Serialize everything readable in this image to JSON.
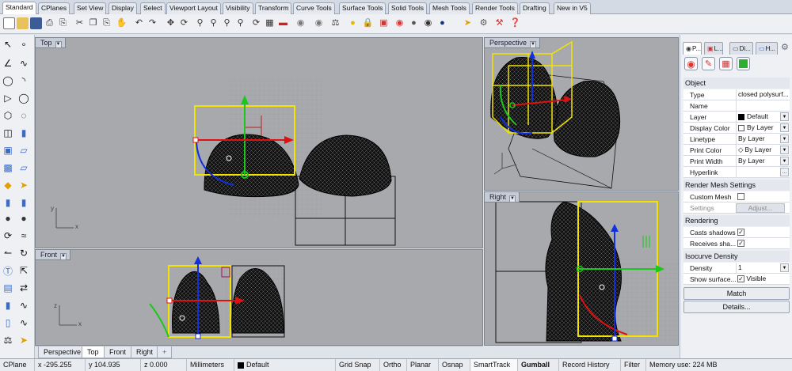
{
  "tabs": [
    {
      "label": "Standard",
      "active": true
    },
    {
      "label": "CPlanes"
    },
    {
      "label": "Set View"
    },
    {
      "label": "Display"
    },
    {
      "label": "Select"
    },
    {
      "label": "Viewport Layout"
    },
    {
      "label": "Visibility"
    },
    {
      "label": "Transform"
    },
    {
      "label": "Curve Tools"
    },
    {
      "label": "Surface Tools"
    },
    {
      "label": "Solid Tools"
    },
    {
      "label": "Mesh Tools"
    },
    {
      "label": "Render Tools"
    },
    {
      "label": "Drafting"
    },
    {
      "label": "New in V5"
    }
  ],
  "toolbar_icons": [
    "new-icon",
    "open-icon",
    "save-icon",
    "print-icon",
    "import-icon",
    "cut-icon",
    "copy-icon",
    "paste-icon",
    "pan-icon",
    "undo-icon",
    "redo-icon",
    "select-icon",
    "rotate-view-icon",
    "zoom-icon",
    "zoom-window-icon",
    "zoom-extents-icon",
    "zoom-selected-icon",
    "4-view-icon",
    "cplane-icon",
    "car-icon",
    "shade-icon",
    "point-icon",
    "lights-icon",
    "lock-icon",
    "layer-icon",
    "render-icon",
    "material-icon",
    "environment-icon",
    "flag-icon",
    "options-icon",
    "help-icon"
  ],
  "viewports": {
    "top": "Top",
    "perspective": "Perspective",
    "front": "Front",
    "right": "Right"
  },
  "axes": {
    "x": "x",
    "y": "y",
    "z": "z"
  },
  "viewport_tabs": [
    {
      "label": "Perspective"
    },
    {
      "label": "Top",
      "active": true
    },
    {
      "label": "Front"
    },
    {
      "label": "Right"
    }
  ],
  "add_tab_label": "+",
  "status": {
    "cplane": "CPlane",
    "x": "x -295.255",
    "y": "y 104.935",
    "z": "z 0.000",
    "units": "Millimeters",
    "layer": "Default",
    "grid_snap": "Grid Snap",
    "ortho": "Ortho",
    "planar": "Planar",
    "osnap": "Osnap",
    "smarttrack": "SmartTrack",
    "gumball": "Gumball",
    "record_history": "Record History",
    "filter": "Filter",
    "memory": "Memory use: 224 MB"
  },
  "panel": {
    "tabs": [
      {
        "label": "P..."
      },
      {
        "label": "L..."
      },
      {
        "label": "Di..."
      },
      {
        "label": "H..."
      }
    ],
    "object_header": "Object",
    "rows": [
      {
        "label": "Type",
        "value": "closed polysurf..."
      },
      {
        "label": "Name",
        "value": ""
      },
      {
        "label": "Layer",
        "value": "Default"
      },
      {
        "label": "Display Color",
        "value": "By Layer"
      },
      {
        "label": "Linetype",
        "value": "By Layer"
      },
      {
        "label": "Print Color",
        "value": "By Layer"
      },
      {
        "label": "Print Width",
        "value": "By Layer"
      },
      {
        "label": "Hyperlink",
        "value": ""
      }
    ],
    "render_mesh_header": "Render Mesh Settings",
    "custom_mesh_label": "Custom Mesh",
    "settings_label": "Settings",
    "adjust_label": "Adjust...",
    "rendering_header": "Rendering",
    "casts_shadows_label": "Casts shadows",
    "receives_shadows_label": "Receives sha...",
    "isocurve_header": "Isocurve Density",
    "density_label": "Density",
    "density_value": "1",
    "show_surface_label": "Show surface...",
    "visible_label": "Visible",
    "match_label": "Match",
    "details_label": "Details...",
    "settings_icon": "gear-icon"
  },
  "colors": {
    "accent_yellow": "#f2e400",
    "gumball_red": "#e01010",
    "gumball_green": "#19c819",
    "gumball_blue": "#1030e0",
    "viewport_bg": "#a7a9ad"
  }
}
